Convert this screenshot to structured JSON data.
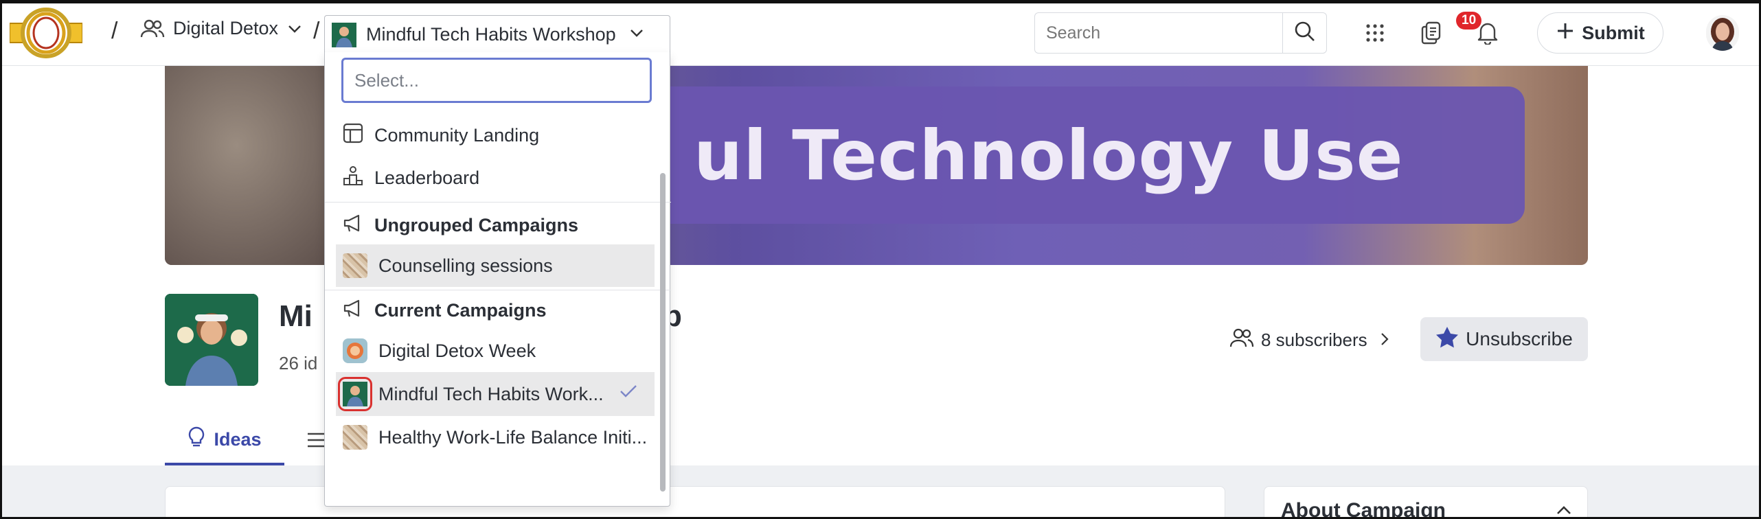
{
  "breadcrumb": {
    "community_label": "Digital Detox",
    "campaign_label": "Mindful Tech Habits Workshop"
  },
  "topbar": {
    "search_placeholder": "Search",
    "notification_count": "10",
    "submit_label": "Submit"
  },
  "banner": {
    "text_visible": "ul Technology Use"
  },
  "campaign": {
    "title_head": "Mi",
    "title_tail": "p",
    "subtitle": "26 id",
    "subscribers_label": "8 subscribers",
    "unsubscribe_label": "Unsubscribe"
  },
  "tabs": {
    "ideas_label": "Ideas"
  },
  "sidebar_card": {
    "title": "About Campaign"
  },
  "dropdown": {
    "search_placeholder": "Select...",
    "nav_items": [
      {
        "label": "Community Landing",
        "icon": "layout-icon"
      },
      {
        "label": "Leaderboard",
        "icon": "leaderboard-icon"
      }
    ],
    "groups": [
      {
        "label": "Ungrouped Campaigns",
        "items": [
          {
            "label": "Counselling sessions",
            "highlighted": true
          }
        ]
      },
      {
        "label": "Current Campaigns",
        "items": [
          {
            "label": "Digital Detox Week"
          },
          {
            "label": "Mindful Tech Habits Work...",
            "selected": true
          },
          {
            "label": "Healthy Work-Life Balance Initi..."
          }
        ]
      }
    ]
  },
  "colors": {
    "accent": "#3c49a8",
    "badge": "#e0262b",
    "focus_ring": "#6a7bd1",
    "highlight": "#e9e9ea"
  }
}
